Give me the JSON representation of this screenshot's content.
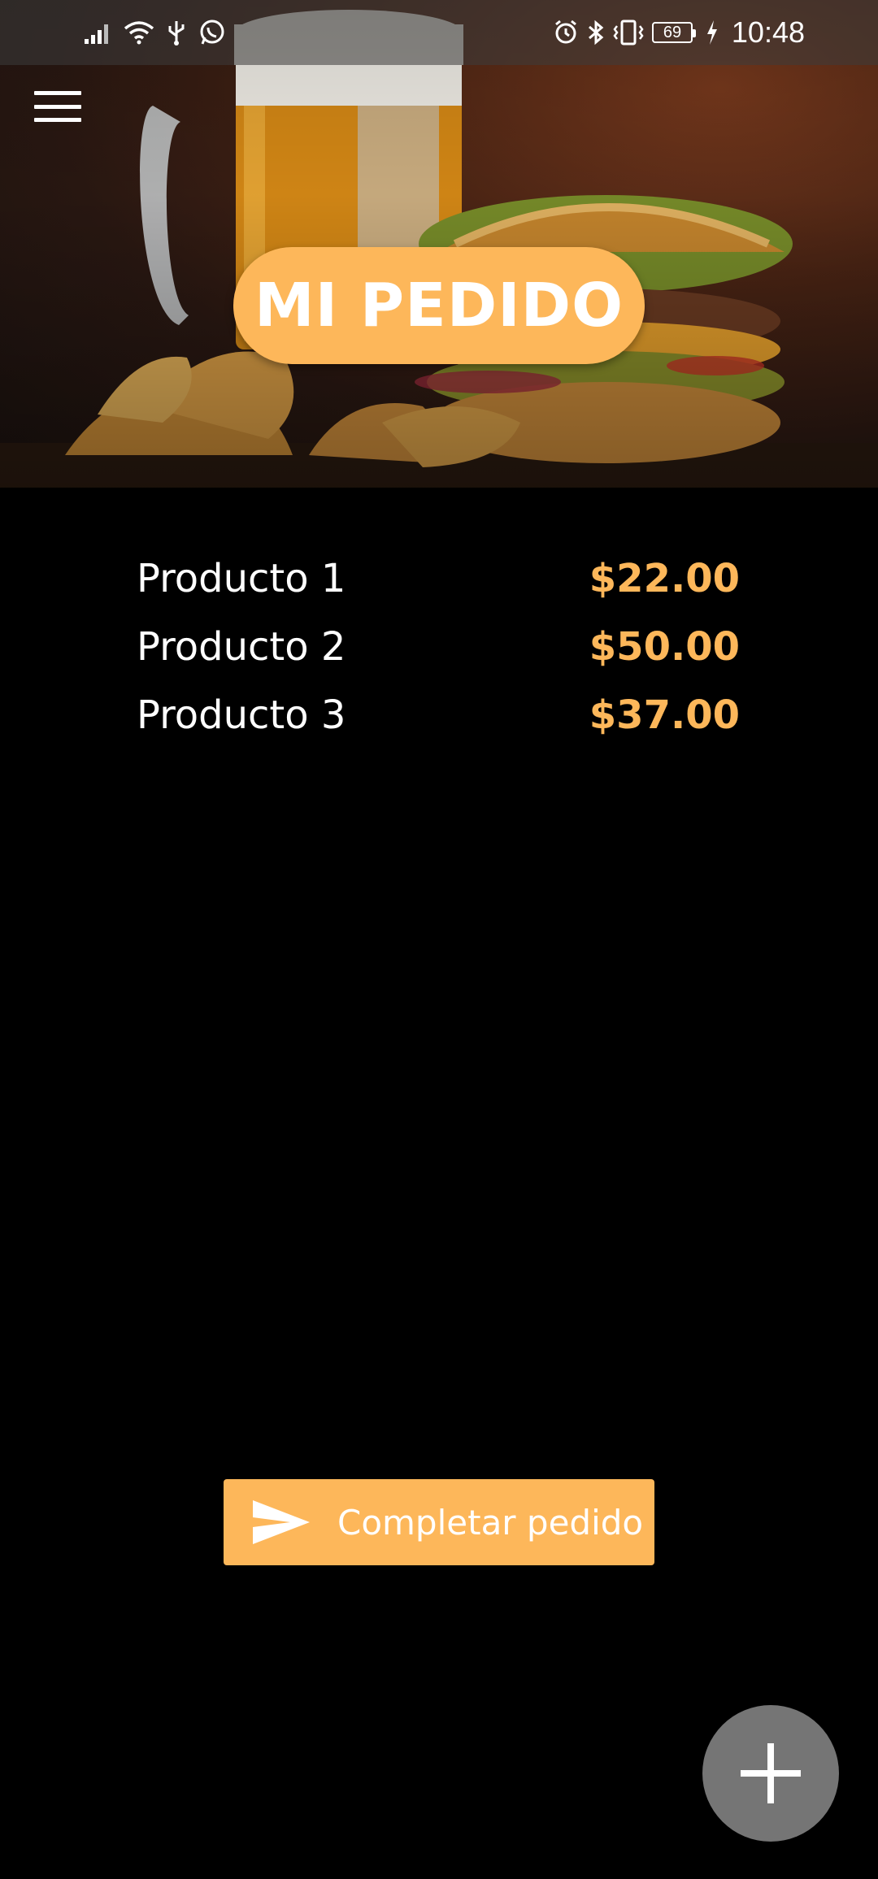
{
  "status_bar": {
    "time": "10:48",
    "battery_level": "69",
    "icons": [
      "signal-icon",
      "wifi-icon",
      "usb-icon",
      "whatsapp-icon",
      "alarm-icon",
      "bluetooth-icon",
      "vibrate-icon",
      "battery-icon",
      "charging-icon"
    ]
  },
  "header": {
    "menu_icon": "hamburger-menu-icon",
    "title": "MI PEDIDO"
  },
  "order": {
    "items": [
      {
        "name": "Producto 1",
        "price": "$22.00"
      },
      {
        "name": "Producto 2",
        "price": "$50.00"
      },
      {
        "name": "Producto 3",
        "price": "$37.00"
      }
    ]
  },
  "actions": {
    "complete_label": "Completar pedido",
    "complete_icon": "send-icon",
    "fab_icon": "plus-icon"
  },
  "colors": {
    "accent": "#fdb75a",
    "background": "#000000",
    "fab": "#757575"
  }
}
